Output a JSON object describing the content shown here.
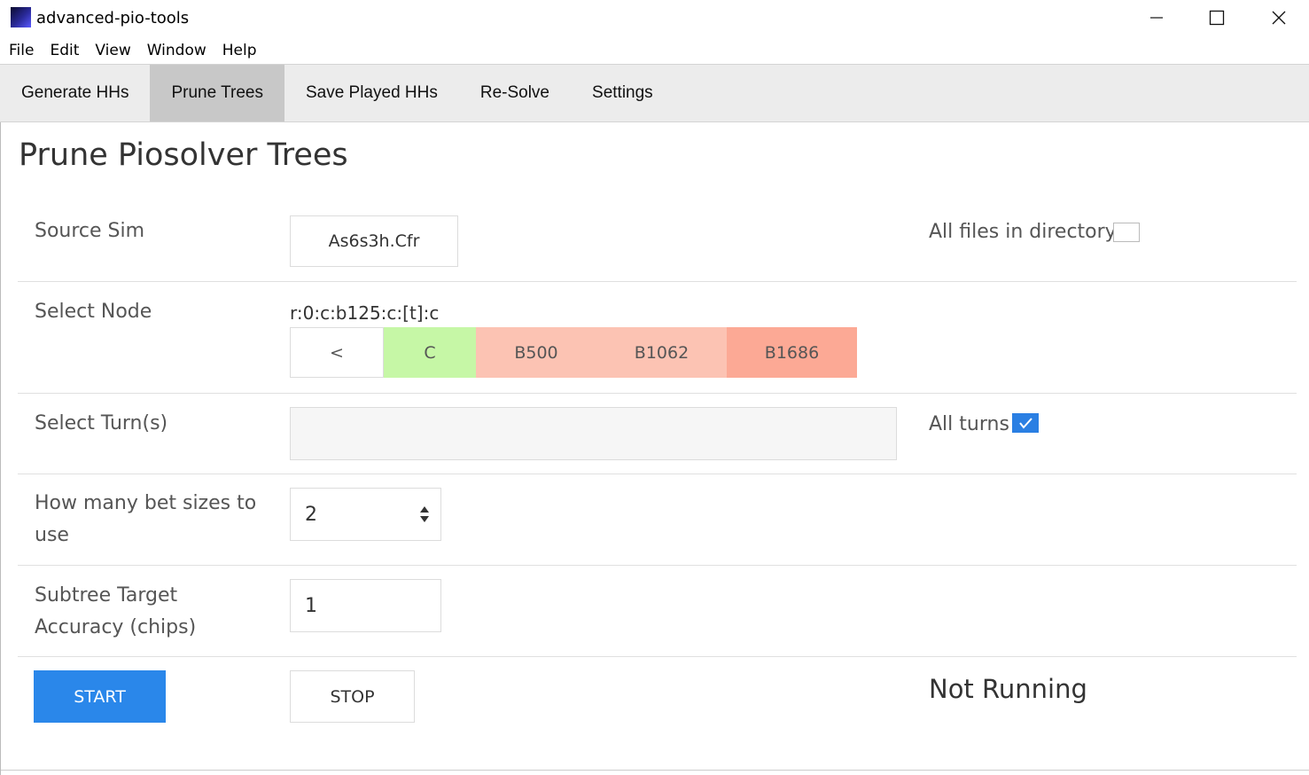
{
  "window": {
    "title": "advanced-pio-tools",
    "minimize_icon": "minimize-icon",
    "maximize_icon": "maximize-icon",
    "close_icon": "close-icon"
  },
  "menu": [
    "File",
    "Edit",
    "View",
    "Window",
    "Help"
  ],
  "tabs": [
    {
      "label": "Generate HHs",
      "active": false
    },
    {
      "label": "Prune Trees",
      "active": true
    },
    {
      "label": "Save Played HHs",
      "active": false
    },
    {
      "label": "Re-Solve",
      "active": false
    },
    {
      "label": "Settings",
      "active": false
    }
  ],
  "page": {
    "title": "Prune Piosolver Trees",
    "source_sim": {
      "label": "Source Sim",
      "file_button": "As6s3h.Cfr",
      "all_files_label": "All files in directory",
      "all_files_checked": false
    },
    "select_node": {
      "label": "Select Node",
      "path": "r:0:c:b125:c:[t]:c",
      "buttons": [
        {
          "label": "<",
          "color": "#ffffff"
        },
        {
          "label": "C",
          "color": "#c6f7a6"
        },
        {
          "label": "B500",
          "color": "#fcc3b3"
        },
        {
          "label": "B1062",
          "color": "#fcc3b3"
        },
        {
          "label": "B1686",
          "color": "#fca995"
        }
      ]
    },
    "select_turns": {
      "label": "Select Turn(s)",
      "all_turns_label": "All turns",
      "all_turns_checked": true
    },
    "bet_sizes": {
      "label_line1": "How many bet sizes to",
      "label_line2": "use",
      "value": "2"
    },
    "accuracy": {
      "label_line1": "Subtree Target",
      "label_line2": "Accuracy (chips)",
      "value": "1"
    },
    "controls": {
      "start_label": "START",
      "stop_label": "STOP",
      "status": "Not Running",
      "accent": "#2a87ea"
    }
  }
}
